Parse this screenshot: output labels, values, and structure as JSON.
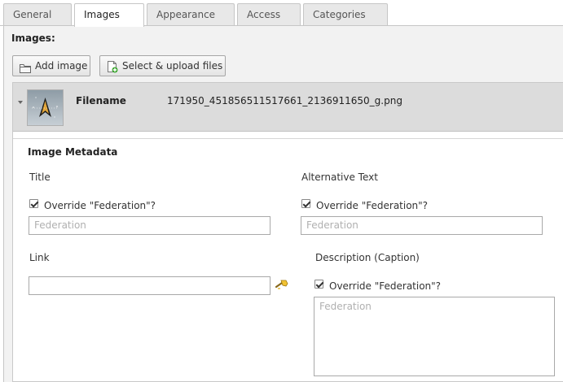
{
  "tabs": [
    {
      "label": "General",
      "active": false
    },
    {
      "label": "Images",
      "active": true
    },
    {
      "label": "Appearance",
      "active": false
    },
    {
      "label": "Access",
      "active": false
    },
    {
      "label": "Categories",
      "active": false
    }
  ],
  "images_section": {
    "title": "Images:",
    "add_image_label": "Add image",
    "upload_label": "Select & upload files"
  },
  "record": {
    "filename_label": "Filename",
    "filename_value": "171950_451856511517661_2136911650_g.png",
    "thumbnail_icon": "starfleet-emblem-icon"
  },
  "metadata": {
    "title": "Image Metadata",
    "fields": {
      "title": {
        "label": "Title",
        "override_label": "Override \"Federation\"?",
        "override_checked": true,
        "placeholder": "Federation"
      },
      "alt": {
        "label": "Alternative Text",
        "override_label": "Override \"Federation\"?",
        "override_checked": true,
        "placeholder": "Federation"
      },
      "link": {
        "label": "Link",
        "value": "",
        "wizard_icon": "link-wizard-icon"
      },
      "description": {
        "label": "Description (Caption)",
        "override_label": "Override \"Federation\"?",
        "override_checked": true,
        "placeholder": "Federation"
      }
    }
  },
  "colors": {
    "tab_bg": "#e8e8e8",
    "panel_header_bg": "#dcdcdc",
    "content_bg": "#f2f2f2"
  }
}
